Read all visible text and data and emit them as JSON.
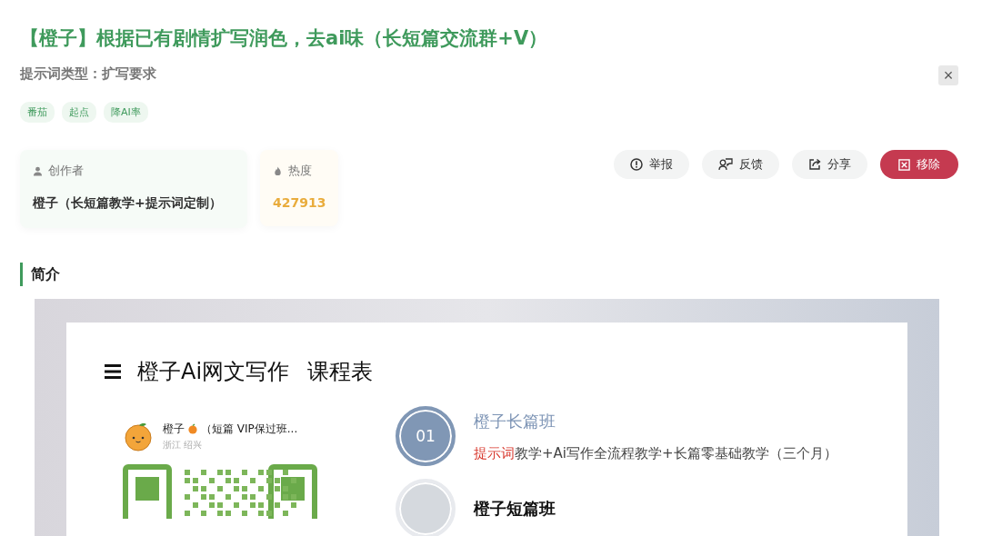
{
  "title": "【橙子】根据已有剧情扩写润色，去ai味（长短篇交流群+V）",
  "prompt_type": "提示词类型：扩写要求",
  "close": "×",
  "tags": [
    "番茄",
    "起点",
    "降AI率"
  ],
  "creator": {
    "label": "创作者",
    "name": "橙子（长短篇教学+提示词定制）"
  },
  "heat": {
    "label": "热度",
    "value": "427913"
  },
  "actions": [
    {
      "label": "举报",
      "kind": "report"
    },
    {
      "label": "反馈",
      "kind": "feedback"
    },
    {
      "label": "分享",
      "kind": "share"
    },
    {
      "label": "移除",
      "kind": "remove"
    }
  ],
  "section_title": "简介",
  "poster": {
    "title": "橙子Ai网文写作",
    "subtitle": "课程表",
    "contact": {
      "name": "橙子",
      "note": "（短篇 VIP保过班...",
      "location": "浙江 绍兴"
    },
    "courses": [
      {
        "number": "01",
        "name": "橙子长篇班",
        "highlight": "提示词",
        "desc": "教学+Ai写作全流程教学+长篇零基础教学（三个月）",
        "selected": true
      },
      {
        "name": "橙子短篇班",
        "selected": false
      }
    ]
  }
}
